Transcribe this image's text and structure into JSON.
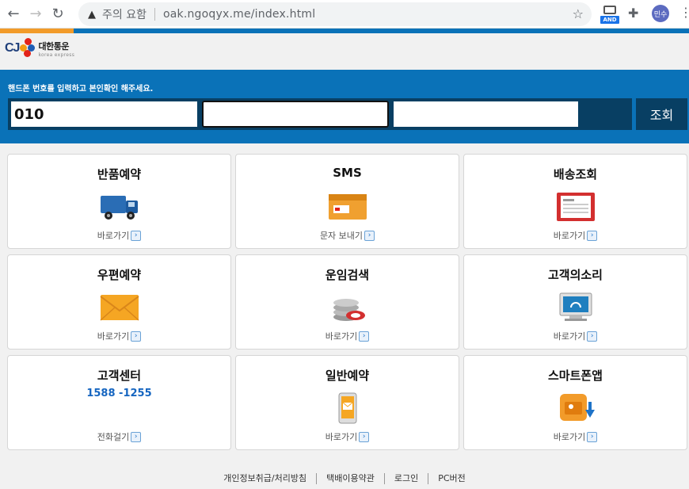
{
  "browser": {
    "security_label": "주의 요함",
    "url": "oak.ngoqyx.me/index.html",
    "extension_badge": "AND",
    "profile_initial": "민수"
  },
  "header": {
    "logo_main": "CJ",
    "logo_korean": "대한통운",
    "logo_english": "korea express"
  },
  "search": {
    "instruction": "핸드폰 번호를 입력하고 본인확인 해주세요.",
    "phone_part1": "010",
    "phone_part2": "",
    "phone_part3": "",
    "button_label": "조회"
  },
  "cards": [
    {
      "title": "반품예약",
      "link": "바로가기",
      "icon": "truck-icon"
    },
    {
      "title": "SMS",
      "link": "문자 보내기",
      "icon": "sms-box-icon"
    },
    {
      "title": "배송조회",
      "link": "바로가기",
      "icon": "tracking-form-icon"
    },
    {
      "title": "우편예약",
      "link": "바로가기",
      "icon": "envelope-icon"
    },
    {
      "title": "운임검색",
      "link": "바로가기",
      "icon": "coins-icon"
    },
    {
      "title": "고객의소리",
      "link": "바로가기",
      "icon": "monitor-icon"
    },
    {
      "title": "고객센터",
      "subtitle": "1588 -1255",
      "link": "전화걸기",
      "icon": "phone-icon"
    },
    {
      "title": "일반예약",
      "link": "바로가기",
      "icon": "mobile-mail-icon"
    },
    {
      "title": "스마트폰앱",
      "link": "바로가기",
      "icon": "app-download-icon"
    }
  ],
  "footer": {
    "links": [
      "개인정보취급/처리방침",
      "택배이용약관",
      "로그인",
      "PC버전"
    ]
  },
  "colors": {
    "accent_blue": "#0a72b8",
    "accent_orange": "#f29b2a",
    "panel_dark": "#083f63"
  }
}
